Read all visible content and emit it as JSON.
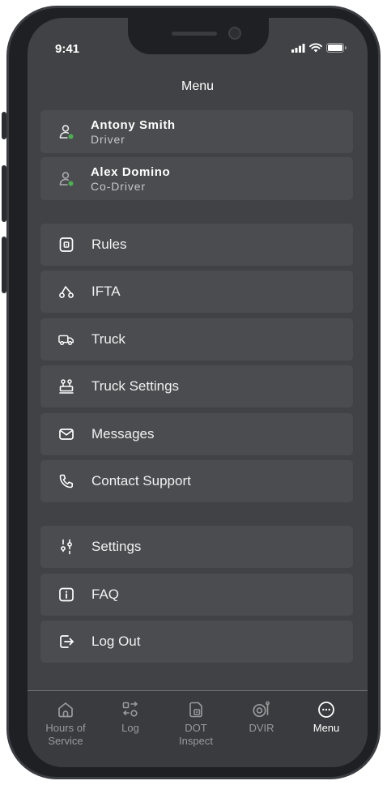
{
  "status_bar": {
    "time": "9:41"
  },
  "header": {
    "title": "Menu"
  },
  "users": [
    {
      "name": "Antony Smith",
      "role": "Driver",
      "icon": "user-active-icon"
    },
    {
      "name": "Alex Domino",
      "role": "Co-Driver",
      "icon": "user-active-icon"
    }
  ],
  "menu_groups": {
    "primary": [
      {
        "label": "Rules",
        "icon": "rules-icon"
      },
      {
        "label": "IFTA",
        "icon": "ifta-icon"
      },
      {
        "label": "Truck",
        "icon": "truck-icon"
      },
      {
        "label": "Truck Settings",
        "icon": "truck-settings-icon"
      },
      {
        "label": "Messages",
        "icon": "mail-icon"
      },
      {
        "label": "Contact Support",
        "icon": "phone-icon"
      }
    ],
    "secondary": [
      {
        "label": "Settings",
        "icon": "sliders-icon"
      },
      {
        "label": "FAQ",
        "icon": "info-icon"
      },
      {
        "label": "Log Out",
        "icon": "logout-icon"
      }
    ]
  },
  "tabbar": {
    "active": "Menu",
    "tabs": [
      {
        "label_line1": "Hours of",
        "label_line2": "Service",
        "icon": "home-icon"
      },
      {
        "label_line1": "Log",
        "label_line2": "",
        "icon": "log-icon"
      },
      {
        "label_line1": "DOT",
        "label_line2": "Inspect",
        "icon": "dot-inspect-icon"
      },
      {
        "label_line1": "DVIR",
        "label_line2": "",
        "icon": "dvir-icon"
      },
      {
        "label_line1": "Menu",
        "label_line2": "",
        "icon": "more-icon"
      }
    ]
  },
  "colors": {
    "screen_bg": "#414245",
    "card_bg": "#4b4c50",
    "online_dot": "#4caf50",
    "inactive_tab": "#9a9a9d"
  }
}
